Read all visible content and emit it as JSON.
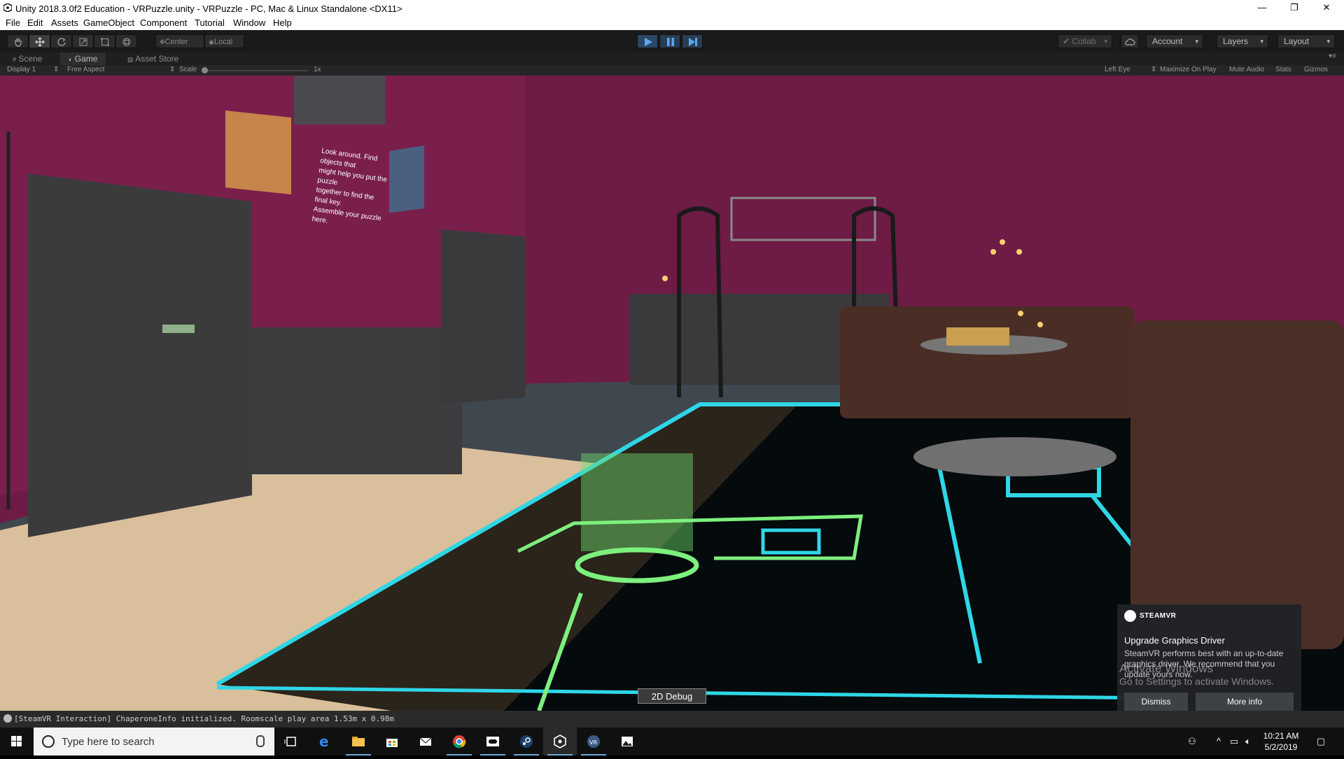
{
  "window": {
    "title": "Unity 2018.3.0f2 Education - VRPuzzle.unity - VRPuzzle - PC, Mac & Linux Standalone <DX11>",
    "minimize_glyph": "—",
    "maximize_glyph": "❐",
    "close_glyph": "✕"
  },
  "menu": [
    "File",
    "Edit",
    "Assets",
    "GameObject",
    "Component",
    "Tutorial",
    "Window",
    "Help"
  ],
  "toolbar": {
    "tools": [
      "hand-tool",
      "move-tool",
      "rotate-tool",
      "scale-tool",
      "rect-tool",
      "transform-tool"
    ],
    "pivot_label": "Center",
    "space_label": "Local",
    "collab_label": "Collab",
    "account_label": "Account",
    "layers_label": "Layers",
    "layout_label": "Layout",
    "playing": true
  },
  "tabs": [
    {
      "label": "Scene",
      "active": false
    },
    {
      "label": "Game",
      "active": true
    },
    {
      "label": "Asset Store",
      "active": false
    }
  ],
  "game_bar": {
    "display": "Display 1",
    "aspect": "Free Aspect",
    "scale_label": "Scale",
    "scale_value": "1x",
    "eye": "Left Eye",
    "maximize": "Maximize On Play",
    "mute": "Mute Audio",
    "stats": "Stats",
    "gizmos": "Gizmos"
  },
  "scene": {
    "wall_text_lines": [
      "Look around. Find objects that",
      "might help you put the puzzle",
      "together to find the final key.",
      "Assemble your puzzle here."
    ],
    "colors": {
      "wall": "#6e1b45",
      "floor": "#d8bd9a",
      "chaperone": "#2fd6e6",
      "teleport": "#7df07d"
    }
  },
  "debug_button": "2D Debug",
  "steamvr": {
    "brand": "STEAMVR",
    "heading": "Upgrade Graphics Driver",
    "body": "SteamVR performs best with an up-to-date graphics driver. We recommend that you update yours now.",
    "dismiss": "Dismiss",
    "more_info": "More info"
  },
  "watermark": {
    "line1": "Activate Windows",
    "line2": "Go to Settings to activate Windows."
  },
  "status": {
    "message": "[SteamVR Interaction] ChaperoneInfo initialized. Roomscale play area 1.53m x 0.98m"
  },
  "taskbar": {
    "search_placeholder": "Type here to search",
    "apps": [
      "task-view",
      "edge",
      "file-explorer",
      "store",
      "mail",
      "chrome",
      "oculus",
      "steam",
      "unity",
      "steamvr",
      "photos"
    ],
    "time": "10:21 AM",
    "date": "5/2/2019"
  }
}
